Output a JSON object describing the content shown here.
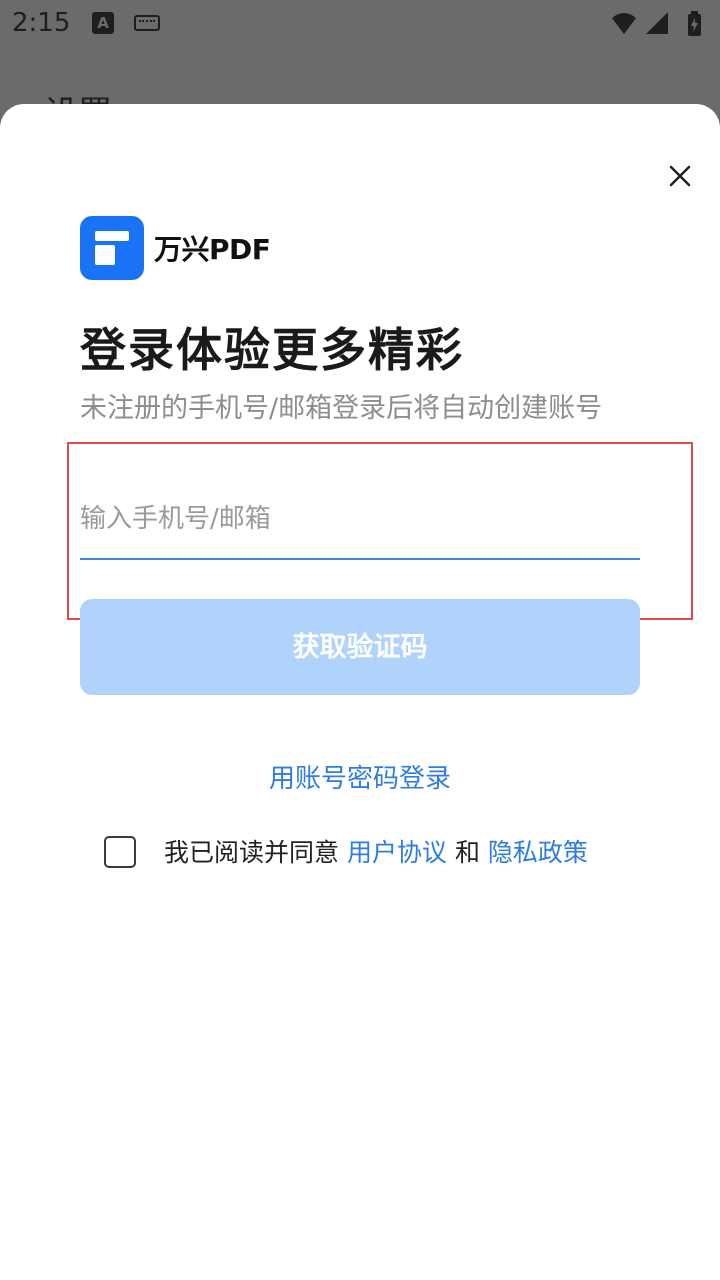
{
  "status_bar": {
    "time": "2:15",
    "a_icon_letter": "A",
    "icons": [
      "a-icon",
      "keyboard-icon",
      "wifi-icon",
      "signal-icon",
      "battery-icon"
    ]
  },
  "background": {
    "title": "设置"
  },
  "sheet": {
    "brand": "万兴PDF",
    "title": "登录体验更多精彩",
    "subtitle": "未注册的手机号/邮箱登录后将自动创建账号",
    "input": {
      "placeholder": "输入手机号/邮箱",
      "value": ""
    },
    "get_code_label": "获取验证码",
    "password_login_label": "用账号密码登录",
    "agreement": {
      "prefix": "我已阅读并同意",
      "user_agreement": "用户协议",
      "conjunction": "和",
      "privacy_policy": "隐私政策",
      "checked": false
    }
  },
  "colors": {
    "accent": "#1a73f5",
    "link": "#2f7de1",
    "button_disabled": "#b0d3fb",
    "highlight": "#e24a4a"
  }
}
